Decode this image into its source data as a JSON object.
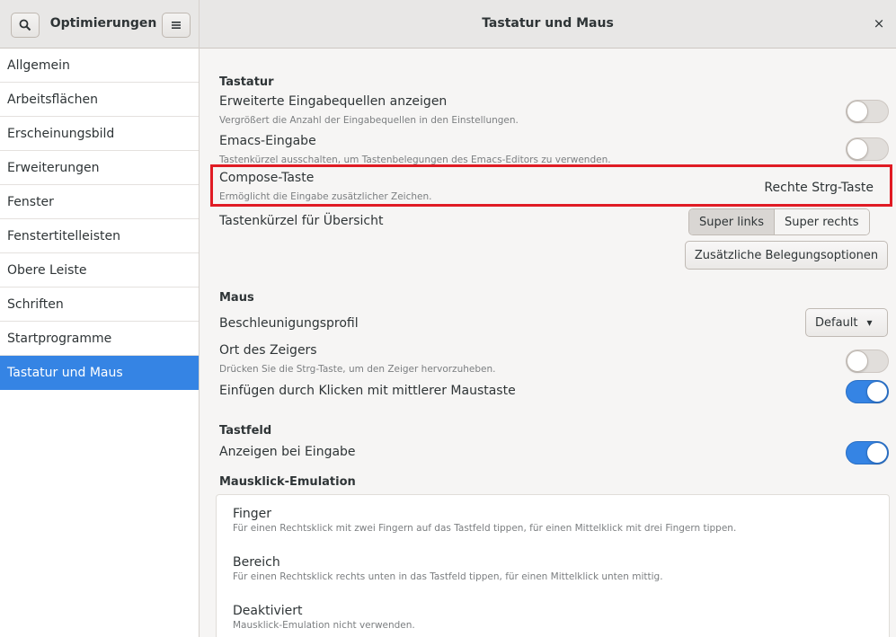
{
  "sidebar": {
    "title": "Optimierungen",
    "search_icon": "search-icon",
    "menu_icon": "hamburger-menu-icon",
    "items": [
      {
        "label": "Allgemein",
        "selected": false
      },
      {
        "label": "Arbeitsflächen",
        "selected": false
      },
      {
        "label": "Erscheinungsbild",
        "selected": false
      },
      {
        "label": "Erweiterungen",
        "selected": false
      },
      {
        "label": "Fenster",
        "selected": false
      },
      {
        "label": "Fenstertitelleisten",
        "selected": false
      },
      {
        "label": "Obere Leiste",
        "selected": false
      },
      {
        "label": "Schriften",
        "selected": false
      },
      {
        "label": "Startprogramme",
        "selected": false
      },
      {
        "label": "Tastatur und Maus",
        "selected": true
      }
    ]
  },
  "header": {
    "title": "Tastatur und Maus",
    "close_symbol": "×"
  },
  "keyboard": {
    "section_title": "Tastatur",
    "extended_sources": {
      "label": "Erweiterte Eingabequellen anzeigen",
      "description": "Vergrößert die Anzahl der Eingabequellen in den Einstellungen.",
      "enabled": false
    },
    "emacs": {
      "label": "Emacs-Eingabe",
      "description": "Tastenkürzel ausschalten, um Tastenbelegungen des Emacs-Editors zu verwenden.",
      "enabled": false
    },
    "compose": {
      "label": "Compose-Taste",
      "description": "Ermöglicht die Eingabe zusätzlicher Zeichen.",
      "value": "Rechte Strg-Taste"
    },
    "overview_shortcut": {
      "label": "Tastenkürzel für Übersicht",
      "options": [
        "Super links",
        "Super rechts"
      ],
      "selected": "Super links"
    },
    "additional_layout_button": "Zusätzliche Belegungsoptionen"
  },
  "mouse": {
    "section_title": "Maus",
    "accel_profile": {
      "label": "Beschleunigungsprofil",
      "value": "Default",
      "dropdown_symbol": "▾"
    },
    "pointer_location": {
      "label": "Ort des Zeigers",
      "description": "Drücken Sie die Strg-Taste, um den Zeiger hervorzuheben.",
      "enabled": false
    },
    "middle_click_paste": {
      "label": "Einfügen durch Klicken mit mittlerer Maustaste",
      "enabled": true
    }
  },
  "touchpad": {
    "section_title": "Tastfeld",
    "show_while_typing": {
      "label": "Anzeigen bei Eingabe",
      "enabled": true
    },
    "click_emulation": {
      "title": "Mausklick-Emulation",
      "options": [
        {
          "label": "Finger",
          "description": "Für einen Rechtsklick mit zwei Fingern auf das Tastfeld tippen, für einen Mittelklick mit drei Fingern tippen."
        },
        {
          "label": "Bereich",
          "description": "Für einen Rechtsklick rechts unten in das Tastfeld tippen, für einen Mittelklick unten mittig."
        },
        {
          "label": "Deaktiviert",
          "description": "Mausklick-Emulation nicht verwenden."
        }
      ]
    }
  },
  "colors": {
    "accent": "#3584e4",
    "highlight_border": "#e01b24"
  }
}
